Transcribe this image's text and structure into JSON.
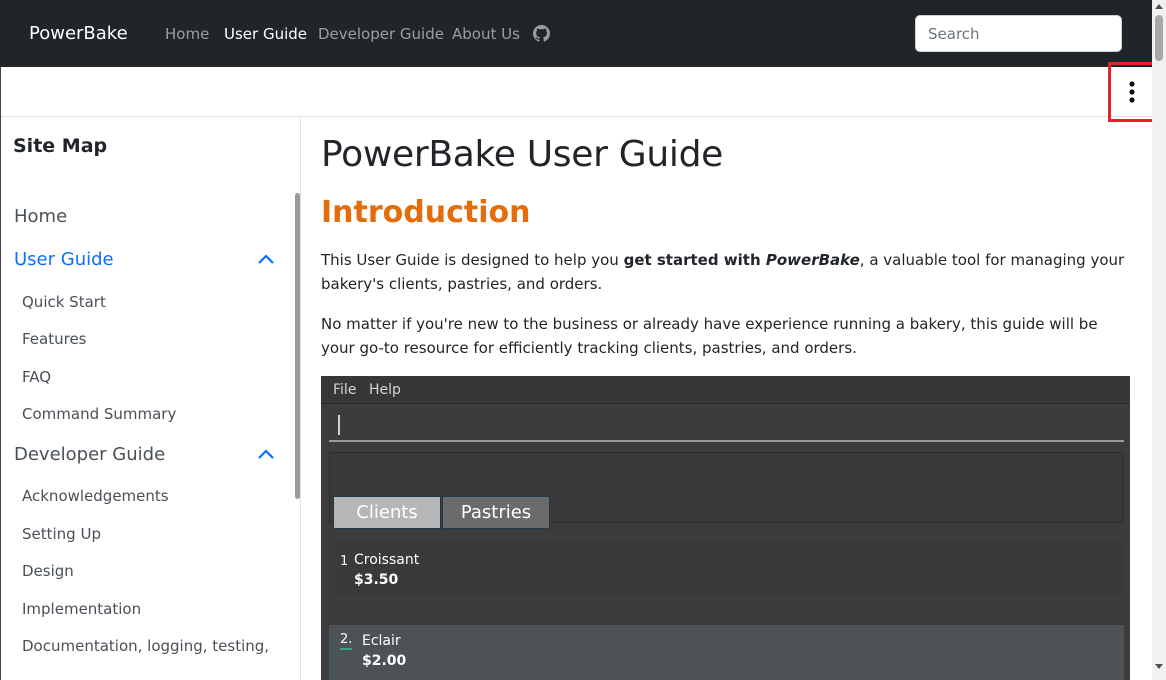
{
  "navbar": {
    "brand": "PowerBake",
    "links": [
      "Home",
      "User Guide",
      "Developer Guide",
      "About Us"
    ],
    "active_link": "User Guide",
    "github_icon": "github-icon",
    "search_placeholder": "Search"
  },
  "toolbar": {
    "menu_icon": "kebab-menu-icon",
    "highlight_color": "#e3242b"
  },
  "sidebar": {
    "title": "Site Map",
    "sections": [
      {
        "label": "Home"
      },
      {
        "label": "User Guide",
        "active": true,
        "expanded": true,
        "items": [
          "Quick Start",
          "Features",
          "FAQ",
          "Command Summary"
        ]
      },
      {
        "label": "Developer Guide",
        "expanded": true,
        "items": [
          "Acknowledgements",
          "Setting Up",
          "Design",
          "Implementation",
          "Documentation, logging, testing,"
        ]
      }
    ]
  },
  "main": {
    "title": "PowerBake User Guide",
    "section_heading": "Introduction",
    "intro": {
      "p1_before": "This User Guide is designed to help you ",
      "p1_bold": "get started with ",
      "p1_bold_italic": "PowerBake",
      "p1_after": ", a valuable tool for managing your bakery's clients, pastries, and orders.",
      "p2": "No matter if you're new to the business or already have experience running a bakery, this guide will be your go-to resource for efficiently tracking clients, pastries, and orders."
    },
    "app_screenshot": {
      "menu": [
        "File",
        "Help"
      ],
      "tabs": [
        "Clients",
        "Pastries"
      ],
      "pastries": [
        {
          "index": "1",
          "name": "Croissant",
          "price": "$3.50"
        },
        {
          "index": "2.",
          "name": "Eclair",
          "price": "$2.00"
        }
      ]
    }
  },
  "colors": {
    "navbar": "#212529",
    "link_active": "#0d6efd",
    "heading_accent": "#e46c0a"
  }
}
